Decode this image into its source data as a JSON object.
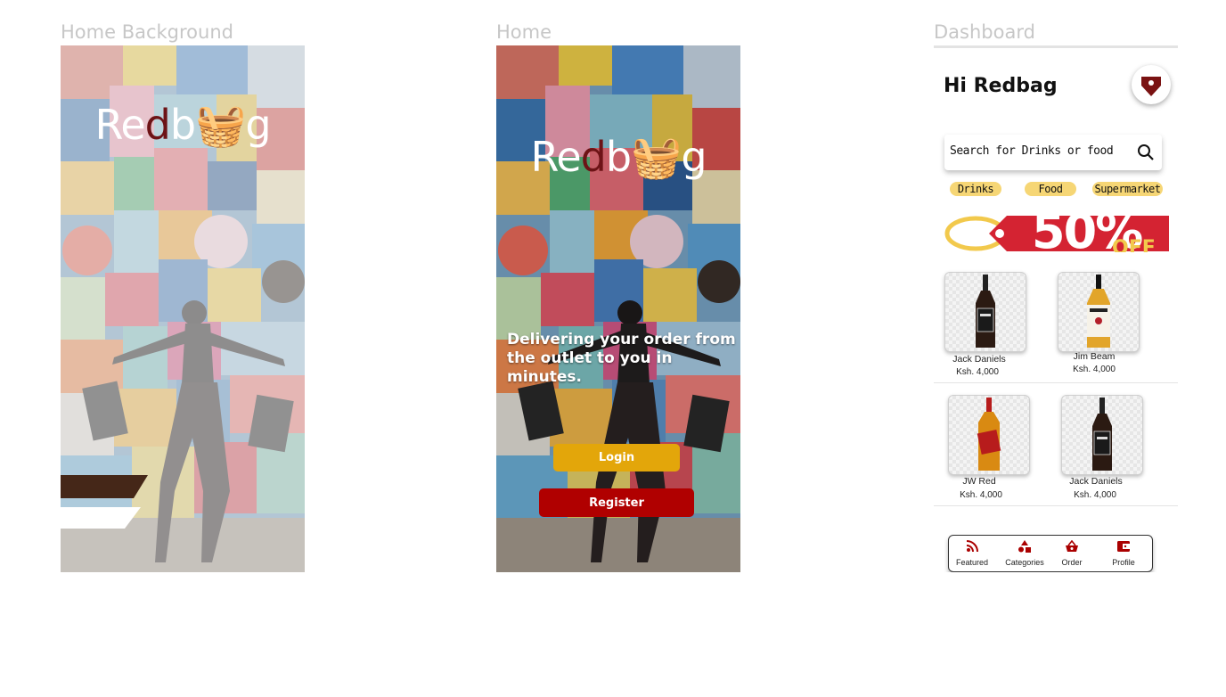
{
  "frames": {
    "home_background": {
      "title": "Home Background"
    },
    "home": {
      "title": "Home"
    },
    "dashboard": {
      "title": "Dashboard"
    }
  },
  "logo": {
    "text": "Redbag"
  },
  "home": {
    "tagline_line1": "Delivering your order from",
    "tagline_line2": "the outlet to you in minutes.",
    "login_label": "Login",
    "register_label": "Register"
  },
  "dashboard": {
    "greeting": "Hi Redbag",
    "search_placeholder": "Search for Drinks or food",
    "categories": [
      "Drinks",
      "Food",
      "Supermarket"
    ],
    "banner": {
      "percent": "50%",
      "off": "OFF"
    },
    "products": [
      {
        "name": "Jack Daniels",
        "price": "Ksh. 4,000"
      },
      {
        "name": "Jim Beam",
        "price": "Ksh. 4,000"
      },
      {
        "name": "JW Red",
        "price": "Ksh. 4,000"
      },
      {
        "name": "Jack Daniels",
        "price": "Ksh. 4,000"
      }
    ],
    "nav": [
      {
        "label": "Featured",
        "icon": "rss-icon"
      },
      {
        "label": "Categories",
        "icon": "shapes-icon"
      },
      {
        "label": "Order",
        "icon": "basket-icon"
      },
      {
        "label": "Profile",
        "icon": "wallet-icon"
      }
    ]
  },
  "colors": {
    "brand_red": "#b00000",
    "brand_maroon": "#6d1316",
    "login_yellow": "#e3a60a",
    "chip_yellow": "#f6d675",
    "banner_red": "#d42332"
  }
}
